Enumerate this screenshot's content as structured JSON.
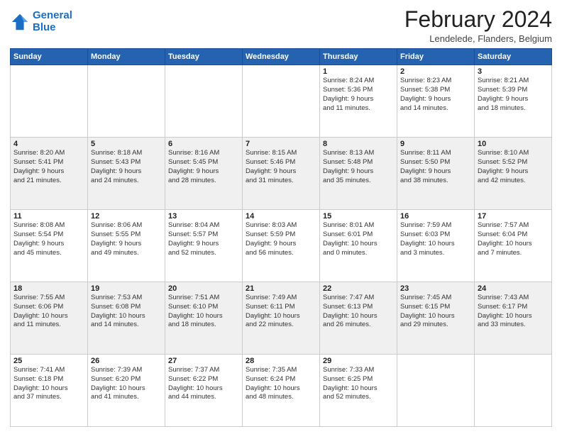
{
  "header": {
    "logo_line1": "General",
    "logo_line2": "Blue",
    "title": "February 2024",
    "subtitle": "Lendelede, Flanders, Belgium"
  },
  "weekdays": [
    "Sunday",
    "Monday",
    "Tuesday",
    "Wednesday",
    "Thursday",
    "Friday",
    "Saturday"
  ],
  "weeks": [
    [
      {
        "day": "",
        "info": ""
      },
      {
        "day": "",
        "info": ""
      },
      {
        "day": "",
        "info": ""
      },
      {
        "day": "",
        "info": ""
      },
      {
        "day": "1",
        "info": "Sunrise: 8:24 AM\nSunset: 5:36 PM\nDaylight: 9 hours\nand 11 minutes."
      },
      {
        "day": "2",
        "info": "Sunrise: 8:23 AM\nSunset: 5:38 PM\nDaylight: 9 hours\nand 14 minutes."
      },
      {
        "day": "3",
        "info": "Sunrise: 8:21 AM\nSunset: 5:39 PM\nDaylight: 9 hours\nand 18 minutes."
      }
    ],
    [
      {
        "day": "4",
        "info": "Sunrise: 8:20 AM\nSunset: 5:41 PM\nDaylight: 9 hours\nand 21 minutes."
      },
      {
        "day": "5",
        "info": "Sunrise: 8:18 AM\nSunset: 5:43 PM\nDaylight: 9 hours\nand 24 minutes."
      },
      {
        "day": "6",
        "info": "Sunrise: 8:16 AM\nSunset: 5:45 PM\nDaylight: 9 hours\nand 28 minutes."
      },
      {
        "day": "7",
        "info": "Sunrise: 8:15 AM\nSunset: 5:46 PM\nDaylight: 9 hours\nand 31 minutes."
      },
      {
        "day": "8",
        "info": "Sunrise: 8:13 AM\nSunset: 5:48 PM\nDaylight: 9 hours\nand 35 minutes."
      },
      {
        "day": "9",
        "info": "Sunrise: 8:11 AM\nSunset: 5:50 PM\nDaylight: 9 hours\nand 38 minutes."
      },
      {
        "day": "10",
        "info": "Sunrise: 8:10 AM\nSunset: 5:52 PM\nDaylight: 9 hours\nand 42 minutes."
      }
    ],
    [
      {
        "day": "11",
        "info": "Sunrise: 8:08 AM\nSunset: 5:54 PM\nDaylight: 9 hours\nand 45 minutes."
      },
      {
        "day": "12",
        "info": "Sunrise: 8:06 AM\nSunset: 5:55 PM\nDaylight: 9 hours\nand 49 minutes."
      },
      {
        "day": "13",
        "info": "Sunrise: 8:04 AM\nSunset: 5:57 PM\nDaylight: 9 hours\nand 52 minutes."
      },
      {
        "day": "14",
        "info": "Sunrise: 8:03 AM\nSunset: 5:59 PM\nDaylight: 9 hours\nand 56 minutes."
      },
      {
        "day": "15",
        "info": "Sunrise: 8:01 AM\nSunset: 6:01 PM\nDaylight: 10 hours\nand 0 minutes."
      },
      {
        "day": "16",
        "info": "Sunrise: 7:59 AM\nSunset: 6:03 PM\nDaylight: 10 hours\nand 3 minutes."
      },
      {
        "day": "17",
        "info": "Sunrise: 7:57 AM\nSunset: 6:04 PM\nDaylight: 10 hours\nand 7 minutes."
      }
    ],
    [
      {
        "day": "18",
        "info": "Sunrise: 7:55 AM\nSunset: 6:06 PM\nDaylight: 10 hours\nand 11 minutes."
      },
      {
        "day": "19",
        "info": "Sunrise: 7:53 AM\nSunset: 6:08 PM\nDaylight: 10 hours\nand 14 minutes."
      },
      {
        "day": "20",
        "info": "Sunrise: 7:51 AM\nSunset: 6:10 PM\nDaylight: 10 hours\nand 18 minutes."
      },
      {
        "day": "21",
        "info": "Sunrise: 7:49 AM\nSunset: 6:11 PM\nDaylight: 10 hours\nand 22 minutes."
      },
      {
        "day": "22",
        "info": "Sunrise: 7:47 AM\nSunset: 6:13 PM\nDaylight: 10 hours\nand 26 minutes."
      },
      {
        "day": "23",
        "info": "Sunrise: 7:45 AM\nSunset: 6:15 PM\nDaylight: 10 hours\nand 29 minutes."
      },
      {
        "day": "24",
        "info": "Sunrise: 7:43 AM\nSunset: 6:17 PM\nDaylight: 10 hours\nand 33 minutes."
      }
    ],
    [
      {
        "day": "25",
        "info": "Sunrise: 7:41 AM\nSunset: 6:18 PM\nDaylight: 10 hours\nand 37 minutes."
      },
      {
        "day": "26",
        "info": "Sunrise: 7:39 AM\nSunset: 6:20 PM\nDaylight: 10 hours\nand 41 minutes."
      },
      {
        "day": "27",
        "info": "Sunrise: 7:37 AM\nSunset: 6:22 PM\nDaylight: 10 hours\nand 44 minutes."
      },
      {
        "day": "28",
        "info": "Sunrise: 7:35 AM\nSunset: 6:24 PM\nDaylight: 10 hours\nand 48 minutes."
      },
      {
        "day": "29",
        "info": "Sunrise: 7:33 AM\nSunset: 6:25 PM\nDaylight: 10 hours\nand 52 minutes."
      },
      {
        "day": "",
        "info": ""
      },
      {
        "day": "",
        "info": ""
      }
    ]
  ]
}
